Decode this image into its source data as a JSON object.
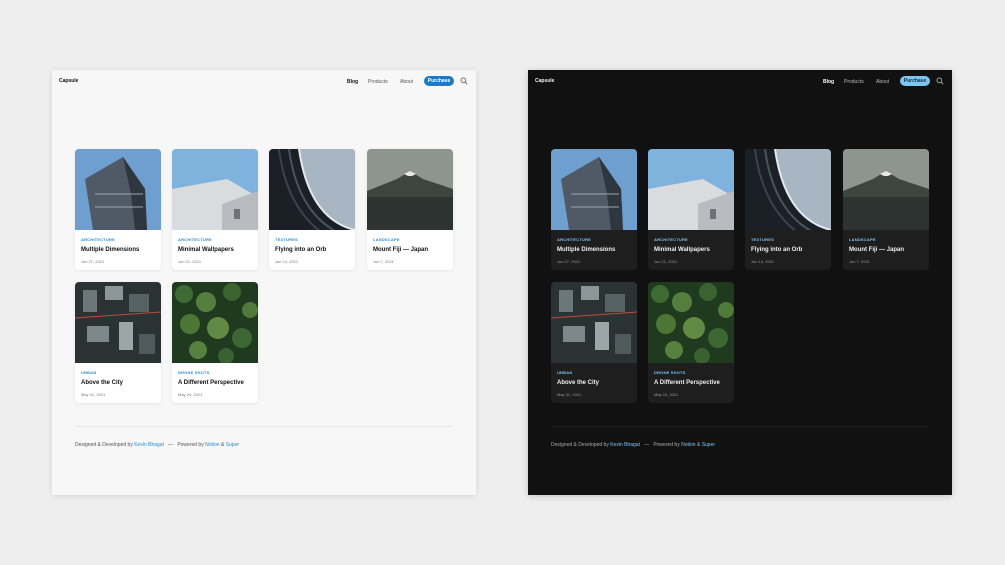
{
  "site": {
    "logo": "Capsule"
  },
  "nav": {
    "blog": "Blog",
    "products": "Products",
    "about": "About",
    "purchase": "Purchase"
  },
  "icons": {
    "search": "search-icon"
  },
  "posts": [
    {
      "category": "ARCHITECTURE",
      "title": "Multiple Dimensions",
      "date": "Jun 27, 2021"
    },
    {
      "category": "ARCHITECTURE",
      "title": "Minimal Wallpapers",
      "date": "Jun 21, 2021"
    },
    {
      "category": "TEXTURES",
      "title": "Flying into an Orb",
      "date": "Jun 14, 2021"
    },
    {
      "category": "LANDSCAPE",
      "title": "Mount Fiji — Japan",
      "date": "Jun 7, 2021"
    },
    {
      "category": "URBAN",
      "title": "Above the City",
      "date": "May 31, 2021"
    },
    {
      "category": "DRONE SHOTS",
      "title": "A Different Perspective",
      "date": "May 24, 2021"
    }
  ],
  "footer": {
    "designed": "Designed & Developed by",
    "author": "Kevin Bhagat",
    "sep": "—",
    "powered": "Powered by",
    "notion": "Notion",
    "amp": "&",
    "super": "Super"
  },
  "colors": {
    "accent_light": "#1e7ac4",
    "accent_dark": "#7fc4f2",
    "bg_light": "#f7f7f7",
    "bg_dark": "#111111"
  }
}
